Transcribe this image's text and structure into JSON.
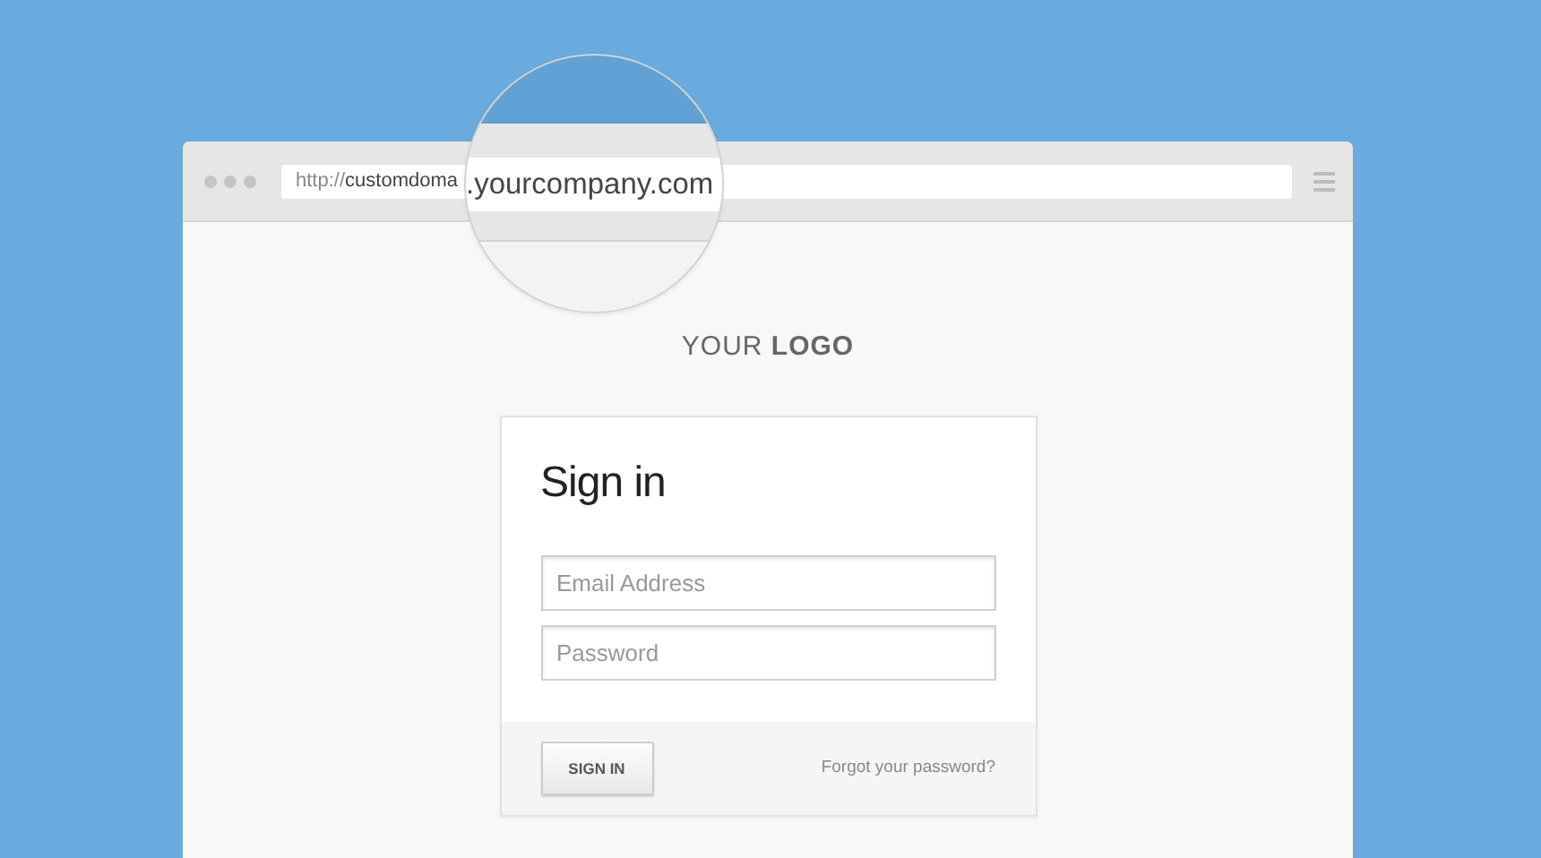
{
  "browser": {
    "address": {
      "protocol": "http://",
      "host": "customdoma"
    },
    "magnified_address": ".yourcompany.com"
  },
  "logo": "YOUR **LOGO**",
  "sign_in": {
    "title": "Sign in",
    "fields": [
      {
        "placeholder": "Email Address"
      },
      {
        "placeholder": "Password"
      }
    ],
    "button": "SIGN IN",
    "link": "Forgot your password?"
  }
}
